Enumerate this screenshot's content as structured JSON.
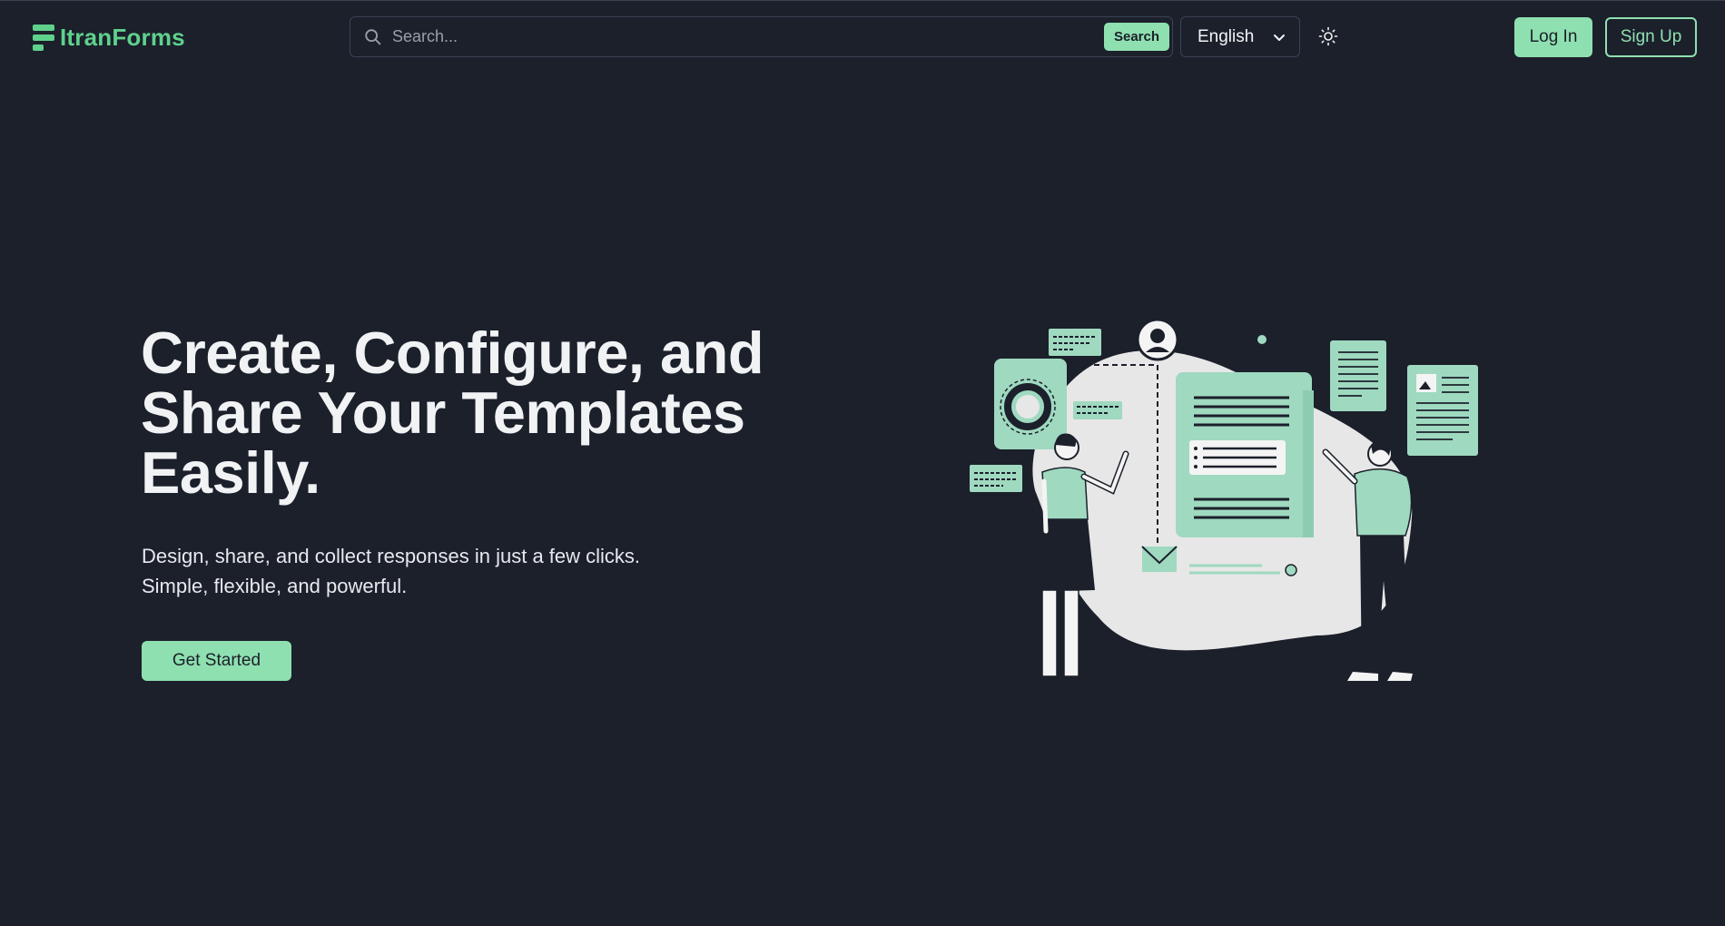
{
  "header": {
    "logo_text": "ItranForms",
    "search": {
      "placeholder": "Search...",
      "button_label": "Search"
    },
    "language": {
      "selected": "English"
    },
    "theme_toggle_icon": "sun-icon",
    "login_label": "Log In",
    "signup_label": "Sign Up"
  },
  "hero": {
    "title": "Create, Configure, and Share Your Templates Easily.",
    "subtitle_line1": "Design, share, and collect responses in just a few clicks.",
    "subtitle_line2": "Simple, flexible, and powerful.",
    "cta_label": "Get Started"
  },
  "colors": {
    "background": "#1b202b",
    "accent": "#8fe0b0",
    "brand": "#5fd18c",
    "text": "#f1f2f4"
  }
}
